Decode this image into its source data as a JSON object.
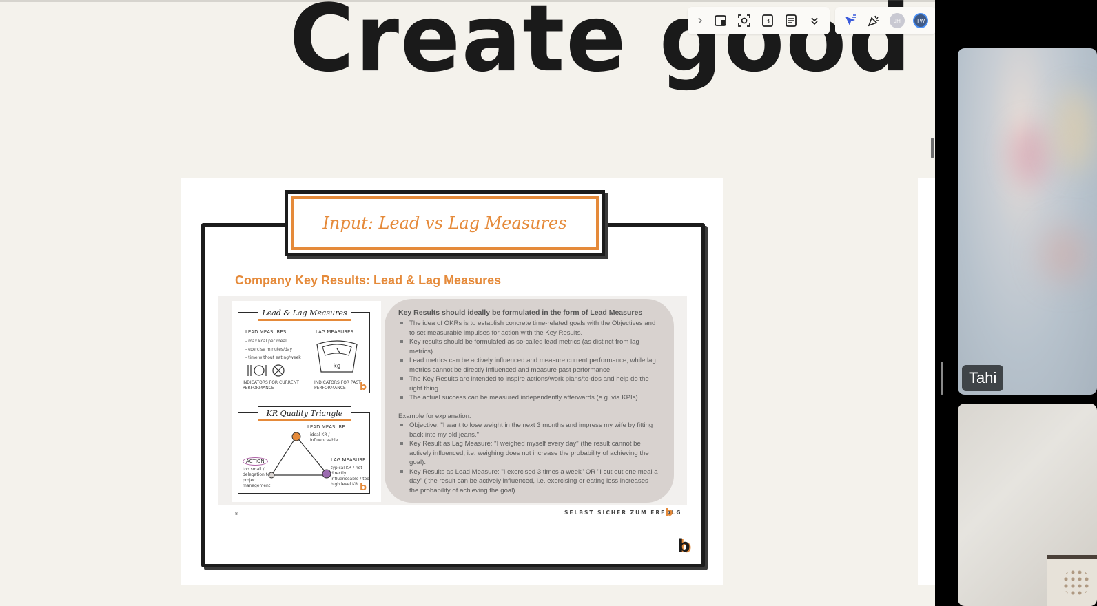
{
  "canvas": {
    "big_title": "Create good K"
  },
  "toolbar": {
    "icons": [
      "chevron-right-icon",
      "sticky-note-icon",
      "focus-icon",
      "timer-icon",
      "notes-icon",
      "double-chevron-down-icon",
      "cursor-share-icon",
      "celebrate-icon"
    ],
    "avatars": [
      {
        "initials": "JH",
        "color": "#c9c9d2"
      },
      {
        "initials": "TW",
        "color": "#3f5a86"
      }
    ]
  },
  "slide": {
    "title_box": "Input: Lead vs Lag Measures",
    "heading": "Company Key Results: Lead & Lag Measures",
    "illustration": {
      "box1": {
        "title": "Lead & Lag Measures",
        "lead_label": "LEAD MEASURES",
        "lag_label": "LAG MEASURES",
        "lead_items": [
          "- max kcal per meal",
          "- exercise minutes/day",
          "- time without eating/week"
        ],
        "scale_unit": "kg",
        "footer_left": "INDICATORS FOR CURRENT PERFORMANCE",
        "footer_right": "INDICATORS FOR PAST PERFORMANCE"
      },
      "box2": {
        "title": "KR Quality Triangle",
        "lead_label": "LEAD MEASURE",
        "lead_note": "ideal KR / influenceable",
        "action_label": "ACTION",
        "action_note": "too small / delegation to project management",
        "lag_label": "LAG MEASURE",
        "lag_note": "typical KR / not directly influenceable / too high level KR"
      },
      "logo": "b"
    },
    "panel": {
      "title": "Key Results should ideally be formulated in the form of Lead Measures",
      "bullets": [
        "The idea of OKRs is to establish concrete time-related goals with the Objectives and to set measurable impulses for action with the Key Results.",
        "Key results should be formulated as so-called lead metrics (as distinct from lag metrics).",
        "Lead metrics can be actively influenced and measure current performance, while lag metrics cannot be directly influenced and measure past performance.",
        "The Key Results are intended to inspire actions/work plans/to-dos and help do the right thing.",
        "The actual success can be measured independently afterwards (e.g. via KPIs)."
      ],
      "example_title": "Example for explanation:",
      "examples": [
        "Objective: \"I want to lose weight in the next 3 months and impress my wife by fitting back into my old jeans.\"",
        "Key Result as Lag Measure: \"I weighed myself every day\" (the result cannot be actively influenced, i.e. weighing does not increase the probability of achieving the goal).",
        "Key Results as Lead Measure: \"I exercised 3 times a week\" OR \"I cut out one meal a day\" ( the result can be actively influenced, i.e. exercising or eating less increases the probability of achieving the goal)."
      ]
    },
    "page_number": "8",
    "footer_tagline": "SELBST SICHER ZUM ERFOLG",
    "footer_logo": "b",
    "corner_logo": "b"
  },
  "video": {
    "participants": [
      {
        "name": "Tahi"
      },
      {
        "name": ""
      }
    ]
  },
  "colors": {
    "accent_orange": "#e58a3a",
    "canvas_bg": "#f4f2ec",
    "panel_bg": "#d8d2cf"
  }
}
